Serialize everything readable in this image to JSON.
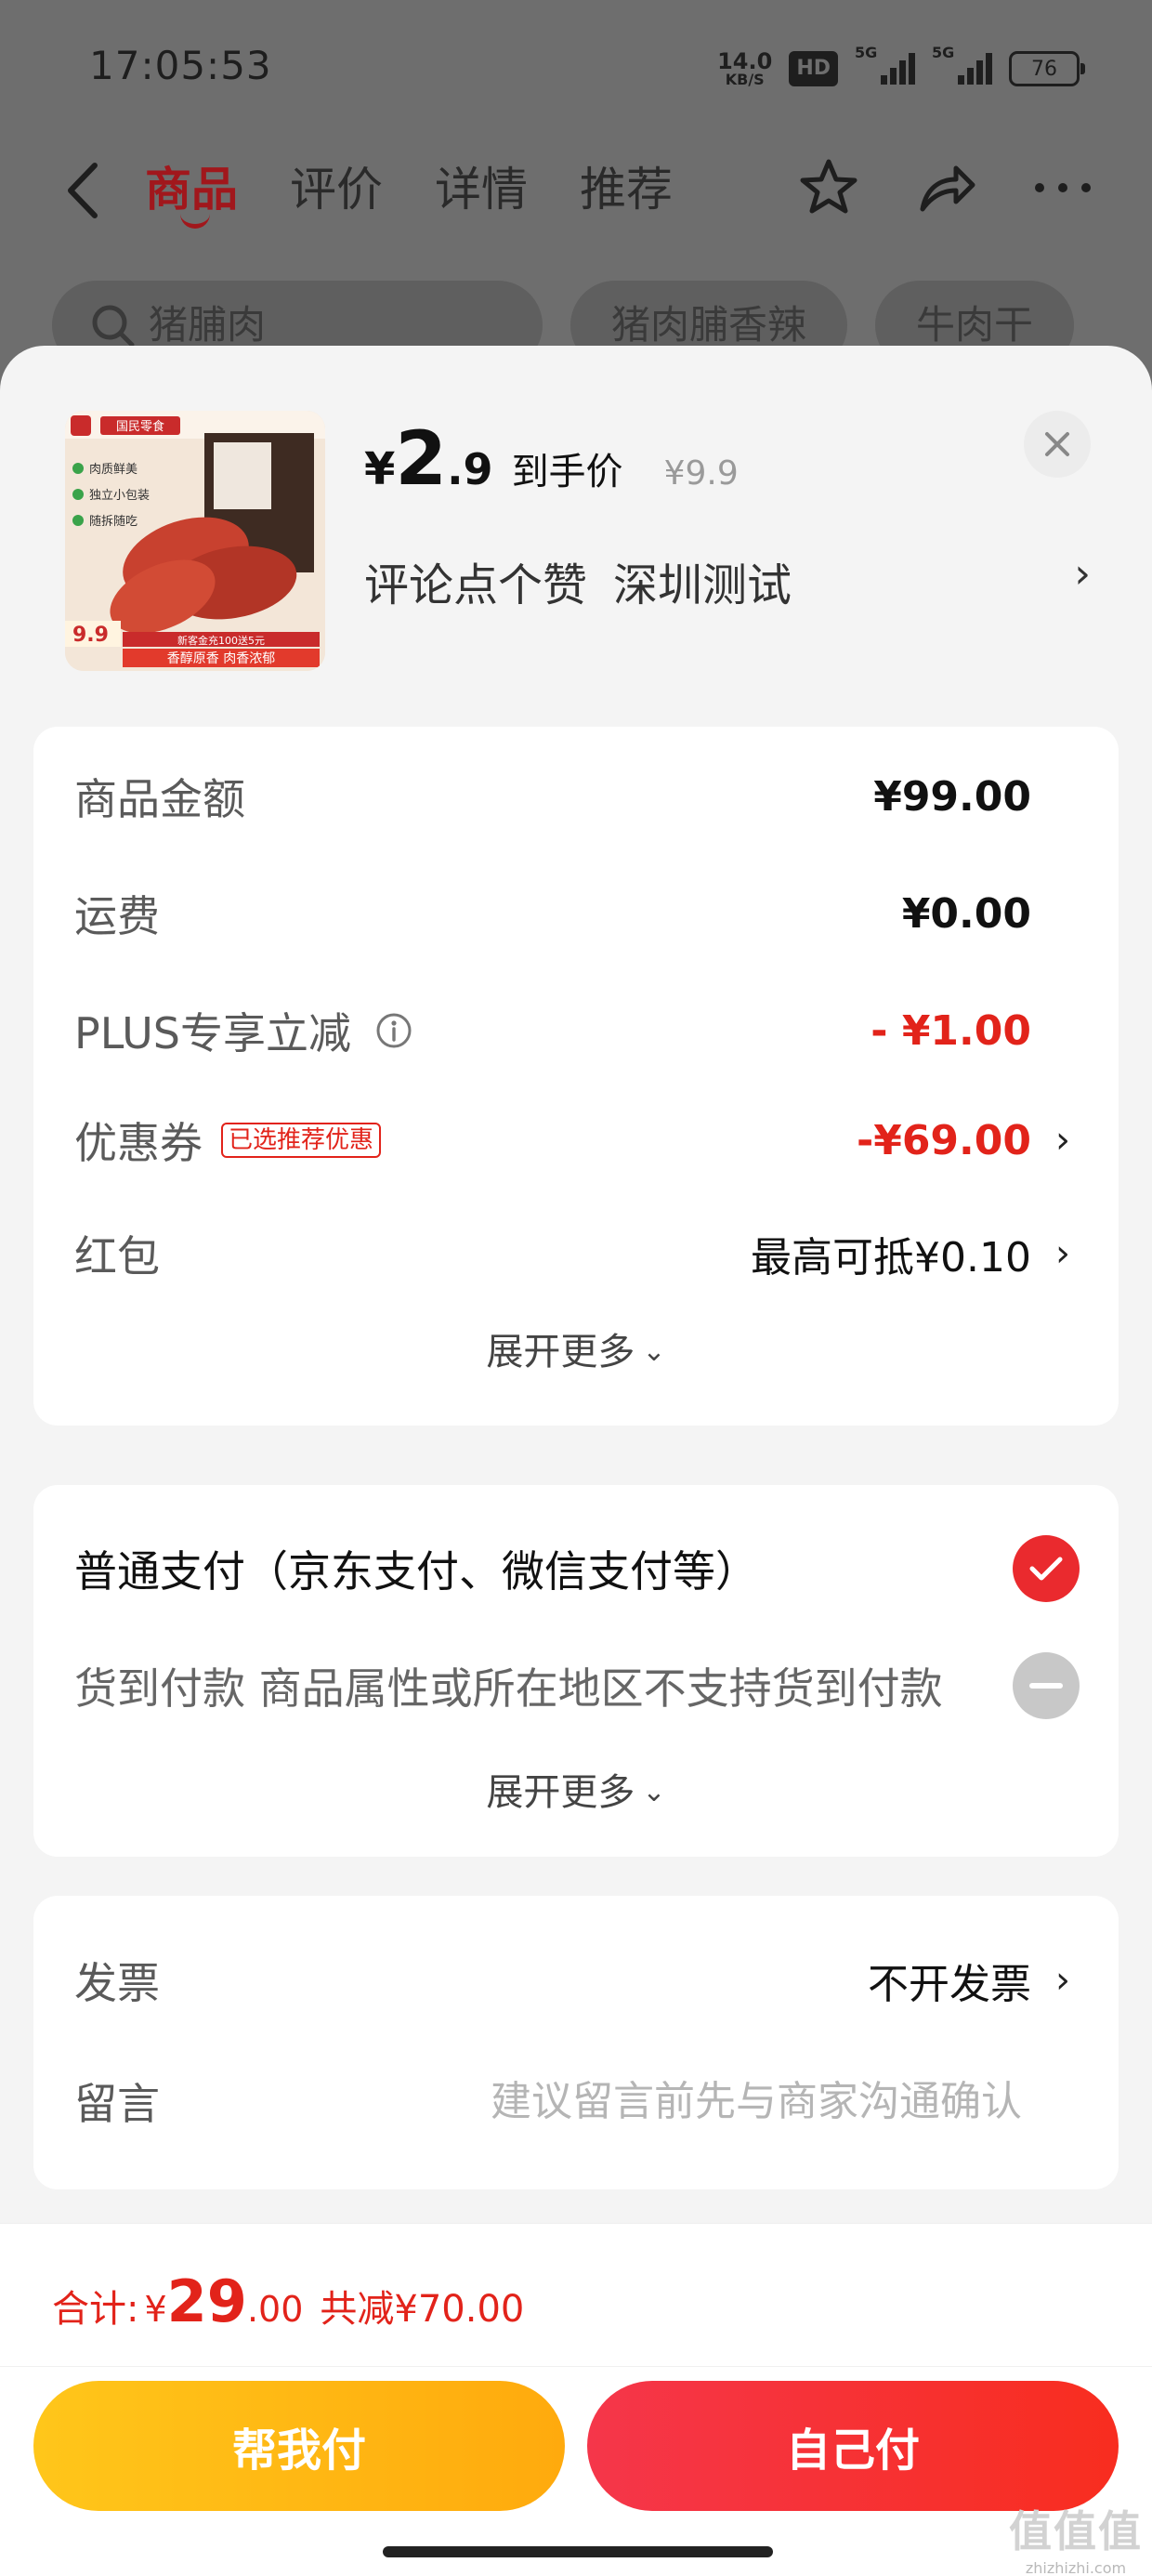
{
  "status_bar": {
    "time": "17:05:53",
    "net_speed": "14.0",
    "net_unit": "KB/S",
    "hd": "HD",
    "sim1": "5G",
    "sim2": "5G",
    "battery": "76"
  },
  "nav": {
    "tabs": [
      {
        "label": "商品",
        "active": true
      },
      {
        "label": "评价",
        "active": false
      },
      {
        "label": "详情",
        "active": false
      },
      {
        "label": "推荐",
        "active": false
      }
    ],
    "icons": [
      "back-icon",
      "star-icon",
      "share-icon",
      "more-icon"
    ]
  },
  "search_row": {
    "search_text": "猪脯肉",
    "chips": [
      "猪肉脯香辣",
      "牛肉干"
    ]
  },
  "product": {
    "price_symbol": "¥",
    "price_int": "2",
    "price_dec": ".9",
    "price_tag": "到手价",
    "original_price": "¥9.9",
    "spec": "评论点个赞",
    "location": "深圳测试",
    "thumb": {
      "brand": "国民零食",
      "bullets": [
        "肉质鲜美",
        "独立小包装",
        "随拆随吃"
      ],
      "price": "9.9",
      "slogan": "香醇原香 肉香浓郁",
      "promo": "新客金充100送5元"
    }
  },
  "cost_card": {
    "rows": [
      {
        "label": "商品金额",
        "value": "¥99.00"
      },
      {
        "label": "运费",
        "value": "¥0.00"
      },
      {
        "label": "PLUS专享立减",
        "value": "- ¥1.00"
      },
      {
        "label": "优惠券",
        "tag": "已选推荐优惠",
        "value": "-¥69.00"
      },
      {
        "label": "红包",
        "value": "最高可抵¥0.10"
      }
    ],
    "expand": "展开更多"
  },
  "pay_card": {
    "options": [
      {
        "label": "普通支付（京东支付、微信支付等）",
        "selected": true
      },
      {
        "label": "货到付款 商品属性或所在地区不支持货到付款",
        "selected": false
      }
    ],
    "expand": "展开更多"
  },
  "misc_card": {
    "invoice_label": "发票",
    "invoice_value": "不开发票",
    "message_label": "留言",
    "message_placeholder": "建议留言前先与商家沟通确认"
  },
  "footer": {
    "total_label": "合计:",
    "total_symbol": "¥",
    "total_int": "29",
    "total_dec": ".00",
    "total_saved": "共减¥70.00",
    "help_pay": "帮我付",
    "self_pay": "自己付"
  },
  "watermark": {
    "logo": "值值值",
    "url": "zhizhizhi.com"
  },
  "colors": {
    "accent_red": "#e2231a",
    "help_yellow": "#ffb20f",
    "self_red": "#f5344a",
    "dim_overlay": "#6e6e6e"
  }
}
